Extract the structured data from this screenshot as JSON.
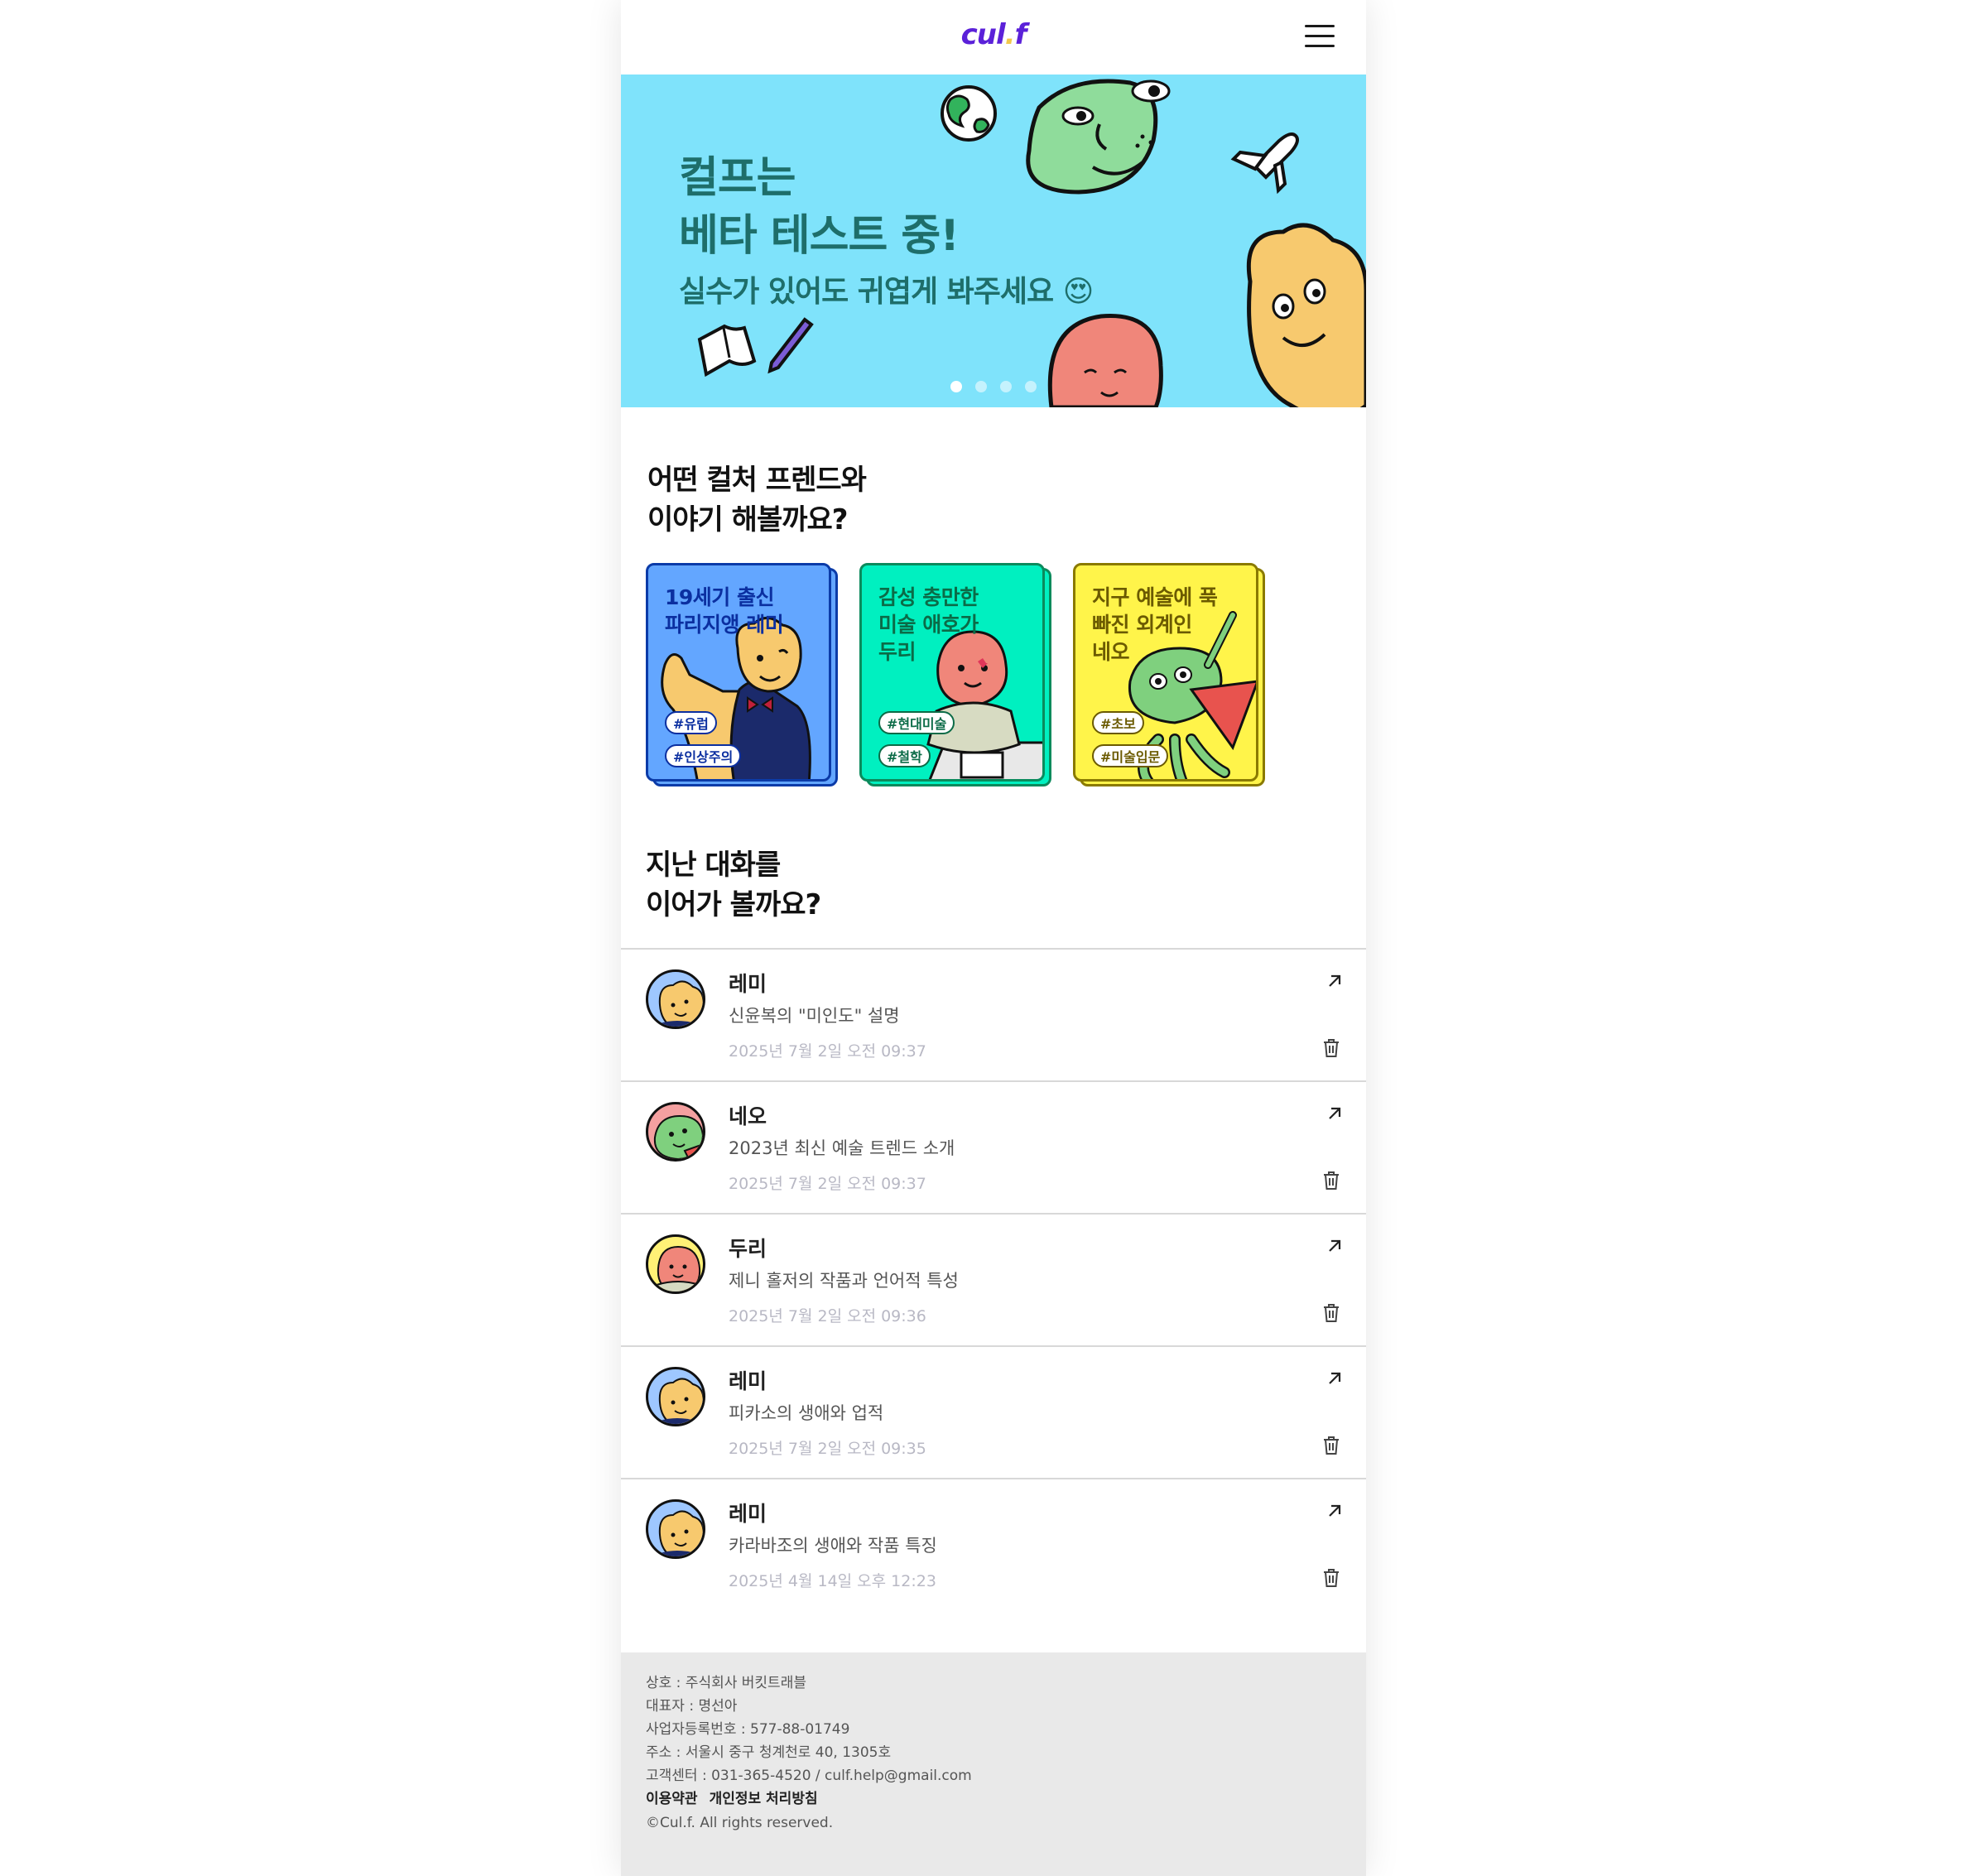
{
  "header": {
    "logo_main": "cul",
    "logo_dot": ".",
    "logo_end": "f",
    "menu_icon": "hamburger-menu-icon"
  },
  "banner": {
    "title": "컬프는\n베타 테스트 중!",
    "subtitle": "실수가 있어도 귀엽게 봐주세요",
    "emoji": "😍",
    "slide_count": 4,
    "active_slide": 1,
    "background": "#7fe3fb"
  },
  "friends_section": {
    "title": "어떤 컬처 프렌드와\n이야기 해볼까요?",
    "cards": [
      {
        "title": "19세기 출신\n파리지앵 레미",
        "tags": [
          "#유럽",
          "#인상주의"
        ],
        "color": "#63a6ff",
        "border": "#0b3ba8",
        "text": "#0b2fa0"
      },
      {
        "title": "감성 충만한\n미술 애호가\n두리",
        "tags": [
          "#현대미술",
          "#철학"
        ],
        "color": "#00f0c0",
        "border": "#0b8a5c",
        "text": "#0b6b47"
      },
      {
        "title": "지구 예술에 푹\n빠진 외계인\n네오",
        "tags": [
          "#초보",
          "#미술입문"
        ],
        "color": "#fff44a",
        "border": "#8a7a00",
        "text": "#6b5a00"
      }
    ]
  },
  "history_section": {
    "title": "지난 대화를\n이어가 볼까요?",
    "items": [
      {
        "name": "레미",
        "topic": "신윤복의 \"미인도\" 설명",
        "date": "2025년 7월 2일 오전 09:37",
        "avatar": "remi"
      },
      {
        "name": "네오",
        "topic": "2023년 최신 예술 트렌드 소개",
        "date": "2025년 7월 2일 오전 09:37",
        "avatar": "neo"
      },
      {
        "name": "두리",
        "topic": "제니 홀저의 작품과 언어적 특성",
        "date": "2025년 7월 2일 오전 09:36",
        "avatar": "duri"
      },
      {
        "name": "레미",
        "topic": "피카소의 생애와 업적",
        "date": "2025년 7월 2일 오전 09:35",
        "avatar": "remi"
      },
      {
        "name": "레미",
        "topic": "카라바조의 생애와 작품 특징",
        "date": "2025년 4월 14일 오후 12:23",
        "avatar": "remi"
      }
    ]
  },
  "footer": {
    "company": "상호 : 주식회사 버킷트래블",
    "ceo": "대표자 : 명선아",
    "business_no": "사업자등록번호 : 577-88-01749",
    "address": "주소 : 서울시 중구 청계천로 40, 1305호",
    "contact": "고객센터 : 031-365-4520 / culf.help@gmail.com",
    "terms_link": "이용약관",
    "privacy_link": "개인정보 처리방침",
    "copyright": "©Cul.f. All rights reserved."
  }
}
